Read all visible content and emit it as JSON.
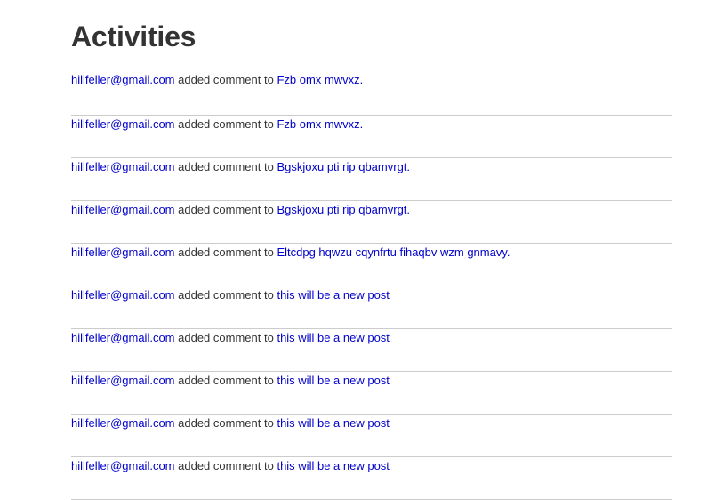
{
  "page": {
    "title": "Activities"
  },
  "activities": [
    {
      "user": "hillfeller@gmail.com",
      "action": "added comment to",
      "target": "Fzb omx mwvxz."
    },
    {
      "user": "hillfeller@gmail.com",
      "action": "added comment to",
      "target": "Fzb omx mwvxz."
    },
    {
      "user": "hillfeller@gmail.com",
      "action": "added comment to",
      "target": "Bgskjoxu pti rip qbamvrgt."
    },
    {
      "user": "hillfeller@gmail.com",
      "action": "added comment to",
      "target": "Bgskjoxu pti rip qbamvrgt."
    },
    {
      "user": "hillfeller@gmail.com",
      "action": "added comment to",
      "target": "Eltcdpg hqwzu cqynfrtu fihaqbv wzm gnmavy."
    },
    {
      "user": "hillfeller@gmail.com",
      "action": "added comment to",
      "target": "this will be a new post"
    },
    {
      "user": "hillfeller@gmail.com",
      "action": "added comment to",
      "target": "this will be a new post"
    },
    {
      "user": "hillfeller@gmail.com",
      "action": "added comment to",
      "target": "this will be a new post"
    },
    {
      "user": "hillfeller@gmail.com",
      "action": "added comment to",
      "target": "this will be a new post"
    },
    {
      "user": "hillfeller@gmail.com",
      "action": "added comment to",
      "target": "this will be a new post"
    }
  ]
}
